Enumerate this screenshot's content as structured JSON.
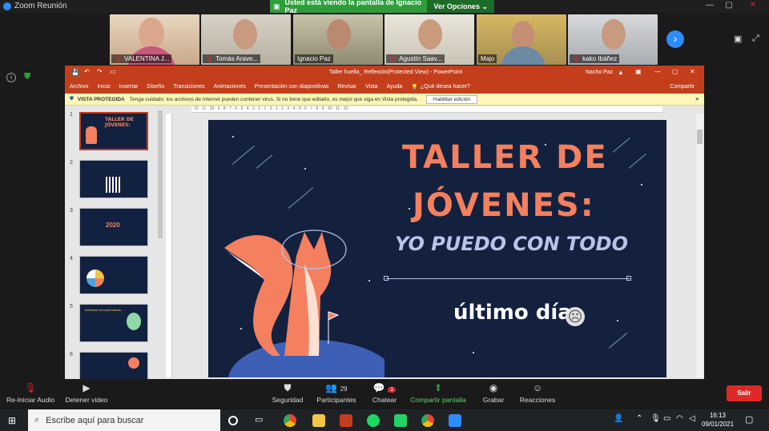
{
  "window": {
    "app_title": "Zoom Reunión"
  },
  "share_banner": {
    "text": "Usted está viendo la pantalla de Ignacio Paz",
    "options_label": "Ver Opciones"
  },
  "gallery": {
    "participants": [
      {
        "name": "VALENTINA J..."
      },
      {
        "name": "Tomás Arave..."
      },
      {
        "name": "Ignacio Paz"
      },
      {
        "name": "Agustín Saav..."
      },
      {
        "name": "Majo"
      },
      {
        "name": "kako Ibáñez"
      }
    ]
  },
  "powerpoint": {
    "title": "Taller huella_ Reflexión(Protected View) - PowerPoint",
    "user": "Nacho Paz",
    "share_label": "Compartir",
    "menu": [
      "Archivo",
      "Inicio",
      "Insertar",
      "Diseño",
      "Transiciones",
      "Animaciones",
      "Presentación con diapositivas",
      "Revisar",
      "Vista",
      "Ayuda"
    ],
    "search_placeholder": "¿Qué desea hacer?",
    "protected_label": "VISTA PROTEGIDA",
    "protected_text": "Tenga cuidado: los archivos de Internet pueden contener virus. Si no tiene que editarlo, es mejor que siga en Vista protegida.",
    "enable_edit_label": "Habilitar edición",
    "thumbnails": [
      {
        "num": "1",
        "text": "TALLER DE JÓVENES:"
      },
      {
        "num": "2",
        "text": ""
      },
      {
        "num": "3",
        "text": "2020"
      },
      {
        "num": "4",
        "text": ""
      },
      {
        "num": "5",
        "text": "Actividad de expectativas"
      },
      {
        "num": "6",
        "text": ""
      }
    ],
    "ruler_text": "· 12 · 11 · 10 · 9 · 8 · 7 · 6 · 5 · 4 · 3 · 2 · 1 · 0 · 1 · 2 · 3 · 4 · 5 · 6 · 7 · 8 · 9 · 10 · 11 · 12 ·",
    "slide": {
      "title_line1": "TALLER DE",
      "title_line2": "JÓVENES:",
      "subtitle": "YO PUEDO CON TODO",
      "caption": "último día",
      "emoji": "☹"
    }
  },
  "controls": {
    "audio": "Re-Iniciar Audio",
    "video": "Detener video",
    "security": "Seguridad",
    "participants": "Participantes",
    "participants_count": "29",
    "chat": "Chatear",
    "chat_badge": "1",
    "share": "Compartir pantalla",
    "record": "Grabar",
    "reactions": "Reacciones",
    "leave": "Salir"
  },
  "taskbar": {
    "search_placeholder": "Escribe aquí para buscar",
    "time": "16:13",
    "date": "09/01/2021"
  },
  "colors": {
    "zoom_blue": "#2d8cff",
    "ppt_red": "#c43e1c",
    "slide_bg": "#13213f",
    "title_orange": "#f4805f",
    "share_green": "#2e9e3c",
    "leave_red": "#e02828"
  }
}
